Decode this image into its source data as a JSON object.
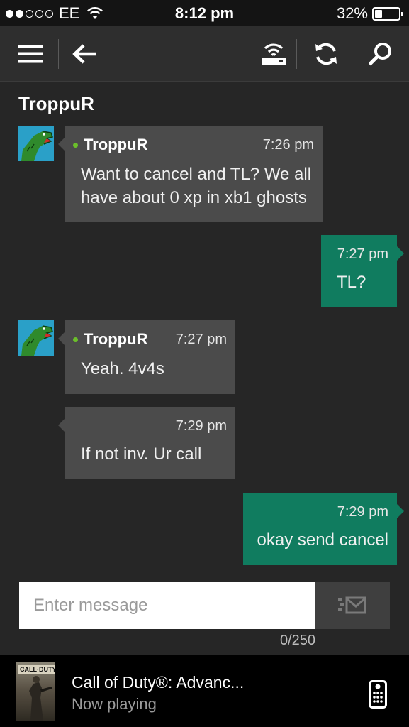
{
  "status_bar": {
    "carrier": "EE",
    "time": "8:12 pm",
    "battery": "32%",
    "battery_level": 0.32,
    "signal_bars_filled": 2,
    "signal_bars_total": 5
  },
  "app_bar": {
    "menu_icon": "hamburger-menu-icon",
    "back_icon": "back-arrow-icon",
    "connect_icon": "console-connection-icon",
    "refresh_icon": "refresh-icon",
    "search_icon": "search-icon"
  },
  "conversation": {
    "title": "TroppuR",
    "messages": [
      {
        "direction": "in",
        "sender": "TroppuR",
        "time": "7:26 pm",
        "lines": [
          "Want to cancel and TL? We all",
          "have about 0 xp in xb1 ghosts"
        ]
      },
      {
        "direction": "out",
        "time": "7:27 pm",
        "lines": [
          "TL?"
        ]
      },
      {
        "direction": "in",
        "sender": "TroppuR",
        "time": "7:27 pm",
        "lines": [
          "Yeah. 4v4s"
        ]
      },
      {
        "direction": "in",
        "time": "7:29 pm",
        "lines": [
          "If not inv. Ur call"
        ]
      },
      {
        "direction": "out",
        "time": "7:29 pm",
        "lines": [
          "okay send cancel"
        ]
      }
    ]
  },
  "composer": {
    "placeholder": "Enter message",
    "value": "",
    "char_count": "0/250",
    "send_icon": "send-message-icon"
  },
  "now_playing": {
    "boxart_text": "CALL·DUTY",
    "title": "Call of Duty®: Advanc...",
    "subtitle": "Now playing",
    "remote_icon": "remote-control-icon"
  },
  "colors": {
    "background": "#262626",
    "incoming_bubble": "#4b4b4b",
    "outgoing_bubble": "#107c5f",
    "online_dot": "#6bbf2a"
  }
}
